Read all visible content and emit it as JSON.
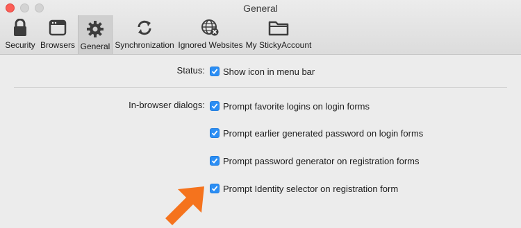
{
  "window": {
    "title": "General"
  },
  "toolbar": {
    "items": [
      {
        "label": "Security",
        "icon": "lock-icon"
      },
      {
        "label": "Browsers",
        "icon": "browser-window-icon"
      },
      {
        "label": "General",
        "icon": "gear-icon",
        "active": true
      },
      {
        "label": "Synchronization",
        "icon": "sync-icon"
      },
      {
        "label": "Ignored Websites",
        "icon": "globe-blocked-icon"
      },
      {
        "label": "My StickyAccount",
        "icon": "folder-icon"
      }
    ]
  },
  "status": {
    "label": "Status:",
    "checkbox": {
      "text": "Show icon in menu bar",
      "checked": true
    }
  },
  "dialogs": {
    "label": "In-browser dialogs:",
    "options": [
      {
        "text": "Prompt favorite logins on login forms",
        "checked": true
      },
      {
        "text": "Prompt earlier generated password on login forms",
        "checked": true
      },
      {
        "text": "Prompt password generator on registration forms",
        "checked": true
      },
      {
        "text": "Prompt Identity selector on registration form",
        "checked": true
      }
    ]
  },
  "colors": {
    "accent": "#2b8ef4",
    "arrow": "#f5731d"
  }
}
